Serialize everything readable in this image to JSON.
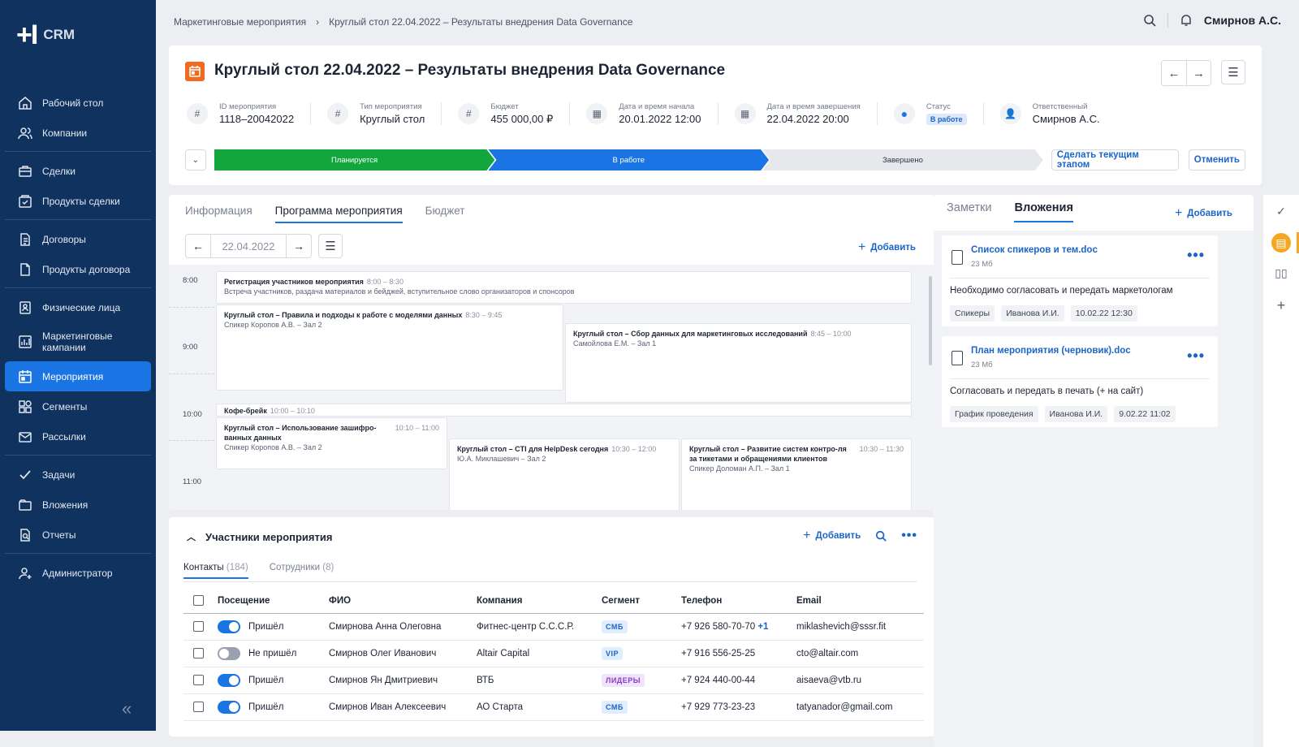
{
  "app": {
    "logo": "CRM"
  },
  "sidebar": {
    "items": [
      {
        "label": "Рабочий стол",
        "icon": "home-icon"
      },
      {
        "label": "Компании",
        "icon": "companies-icon"
      },
      {
        "label": "Сделки",
        "icon": "briefcase-icon"
      },
      {
        "label": "Продукты сделки",
        "icon": "cart-icon"
      },
      {
        "label": "Договоры",
        "icon": "contract-icon"
      },
      {
        "label": "Продукты договора",
        "icon": "document-icon"
      },
      {
        "label": "Физические лица",
        "icon": "person-card-icon"
      },
      {
        "label": "Маркетинговые кампании",
        "icon": "chart-icon"
      },
      {
        "label": "Мероприятия",
        "icon": "calendar-icon"
      },
      {
        "label": "Сегменты",
        "icon": "segments-icon"
      },
      {
        "label": "Рассылки",
        "icon": "mail-icon"
      },
      {
        "label": "Задачи",
        "icon": "check-icon"
      },
      {
        "label": "Вложения",
        "icon": "attachment-icon"
      },
      {
        "label": "Отчеты",
        "icon": "report-icon"
      },
      {
        "label": "Администратор",
        "icon": "admin-icon"
      }
    ],
    "active": "Мероприятия"
  },
  "topbar": {
    "breadcrumb": [
      "Маркетинговые мероприятия",
      "Круглый стол 22.04.2022 – Результаты внедрения Data Governance"
    ],
    "user": "Смирнов А.С."
  },
  "event": {
    "title": "Круглый стол 22.04.2022 – Результаты внедрения Data Governance",
    "fields": [
      {
        "label": "ID мероприятия",
        "value": "1118–20042022",
        "icon": "hash-icon"
      },
      {
        "label": "Тип мероприятия",
        "value": "Круглый стол",
        "icon": "hash-icon"
      },
      {
        "label": "Бюджет",
        "value": "455 000,00 ₽",
        "icon": "hash-icon"
      },
      {
        "label": "Дата и время начала",
        "value": "20.01.2022 12:00",
        "icon": "calendar-icon"
      },
      {
        "label": "Дата и время завершения",
        "value": "22.04.2022 20:00",
        "icon": "calendar-icon"
      },
      {
        "label": "Статус",
        "value": "В работе",
        "icon": "status-dot-icon"
      },
      {
        "label": "Ответственный",
        "value": "Смирнов А.С.",
        "icon": "user-icon"
      }
    ],
    "stages": [
      "Планируется",
      "В работе",
      "Завершено"
    ],
    "stage_buttons": [
      "Сделать текущим этапом",
      "Отменить"
    ]
  },
  "program": {
    "tabs": [
      "Информация",
      "Программа мероприятия",
      "Бюджет"
    ],
    "active_tab": "Программа мероприятия",
    "date": "22.04.2022",
    "add_label": "Добавить",
    "times": [
      "8:00",
      "9:00",
      "10:00",
      "11:00"
    ],
    "events": [
      {
        "title": "Регистрация участников мероприятия",
        "time": "8:00 – 8:30",
        "sub": "Встреча участников, раздача материалов и бейджей, вступительное слово организаторов и спонсоров"
      },
      {
        "title": "Круглый стол – Правила и подходы к работе с моделями данных",
        "time": "8:30 – 9:45",
        "sub": "Спикер Коропов А.В. – Зал 2"
      },
      {
        "title": "Круглый стол – Сбор данных для маркетинговых исследований",
        "time": "8:45 – 10:00",
        "sub": "Самойлова Е.М. – Зал 1"
      },
      {
        "title": "Кофе-брейк",
        "time": "10:00 – 10:10",
        "sub": ""
      },
      {
        "title": "Круглый стол – Использование зашифро-ванных данных",
        "time": "10:10 – 11:00",
        "sub": "Спикер Коропов А.В. – Зал 2"
      },
      {
        "title": "Круглый стол – CTI для HelpDesk сегодня",
        "time": "10:30 – 12:00",
        "sub": "Ю.А. Миклашевич – Зал 2"
      },
      {
        "title": "Круглый стол – Развитие систем контро-ля за тикетами и обращениями клиентов",
        "time": "10:30 – 11:30",
        "sub": "Спикер Доломан А.П. – Зал 1"
      }
    ]
  },
  "participants": {
    "title": "Участники мероприятия",
    "add_label": "Добавить",
    "tabs": [
      {
        "label": "Контакты",
        "count": "(184)"
      },
      {
        "label": "Сотрудники",
        "count": "(8)"
      }
    ],
    "columns": [
      "Посещение",
      "ФИО",
      "Компания",
      "Сегмент",
      "Телефон",
      "Email"
    ],
    "rows": [
      {
        "attended": true,
        "status": "Пришёл",
        "name": "Смирнова Анна Олеговна",
        "company": "Фитнес-центр С.С.С.Р.",
        "segment": "СМБ",
        "phone": "+7 926 580-70-70",
        "phone_extra": "+1",
        "email": "miklashevich@sssr.fit"
      },
      {
        "attended": false,
        "status": "Не пришёл",
        "name": "Смирнов Олег Иванович",
        "company": "Altair Capital",
        "segment": "VIP",
        "phone": "+7 916 556-25-25",
        "phone_extra": "",
        "email": "cto@altair.com"
      },
      {
        "attended": true,
        "status": "Пришёл",
        "name": "Смирнов Ян Дмитриевич",
        "company": "ВТБ",
        "segment": "ЛИДЕРЫ",
        "phone": "+7 924 440-00-44",
        "phone_extra": "",
        "email": "aisaeva@vtb.ru"
      },
      {
        "attended": true,
        "status": "Пришёл",
        "name": "Смирнов Иван Алексеевич",
        "company": "АО Старта",
        "segment": "СМБ",
        "phone": "+7 929 773-23-23",
        "phone_extra": "",
        "email": "tatyanador@gmail.com"
      }
    ]
  },
  "attachments": {
    "tabs": [
      "Заметки",
      "Вложения"
    ],
    "active_tab": "Вложения",
    "add_label": "Добавить",
    "files": [
      {
        "name": "Список спикеров и тем.doc",
        "size": "23 Мб",
        "note": "Необходимо согласовать и передать маркетологам",
        "tags": [
          "Спикеры",
          "Иванова И.И.",
          "10.02.22 12:30"
        ]
      },
      {
        "name": "План мероприятия (черновик).doc",
        "size": "23 Мб",
        "note": "Согласовать и передать в печать (+ на сайт)",
        "tags": [
          "График проведения",
          "Иванова И.И.",
          "9.02.22 11:02"
        ]
      }
    ]
  },
  "colors": {
    "sidebar": "#10325e",
    "accent": "#1b74e4",
    "stage_done": "#12a63c",
    "event_icon": "#f06a1f",
    "rail_active": "#f5a623"
  }
}
